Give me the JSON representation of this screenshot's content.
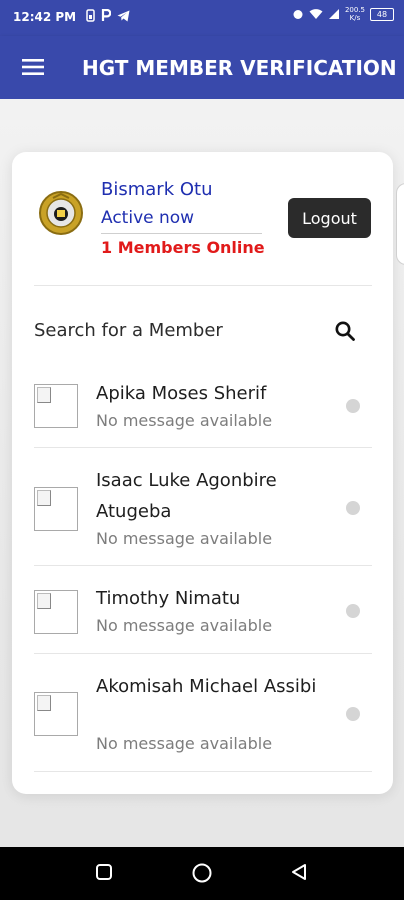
{
  "status_bar": {
    "time": "12:42 PM",
    "left_icons": [
      "sim-icon",
      "parking-icon",
      "telegram-icon"
    ],
    "net_speed_value": "200.5",
    "net_speed_unit": "K/s",
    "battery": "48"
  },
  "app_bar": {
    "menu_icon": "hamburger-icon",
    "title": "HGT MEMBER VERIFICATION",
    "color": "#3949ab"
  },
  "profile": {
    "name": "Bismark Otu",
    "status": "Active now",
    "online_text": "1 Members Online",
    "logout_label": "Logout",
    "name_color": "#1f2fb0",
    "online_color": "#e11a1a"
  },
  "search": {
    "label": "Search for a Member",
    "icon": "search-icon"
  },
  "members": [
    {
      "name": "Apika Moses Sherif",
      "message": "No message available",
      "online": false
    },
    {
      "name": "Isaac Luke Agonbire Atugeba",
      "message": "No message available",
      "online": false
    },
    {
      "name": "Timothy Nimatu",
      "message": "No message available",
      "online": false
    },
    {
      "name": "Akomisah Michael Assibi",
      "message": "No message available",
      "online": false
    }
  ],
  "nav_bar": {
    "recents_icon": "square-icon",
    "home_icon": "circle-icon",
    "back_icon": "triangle-back-icon"
  }
}
